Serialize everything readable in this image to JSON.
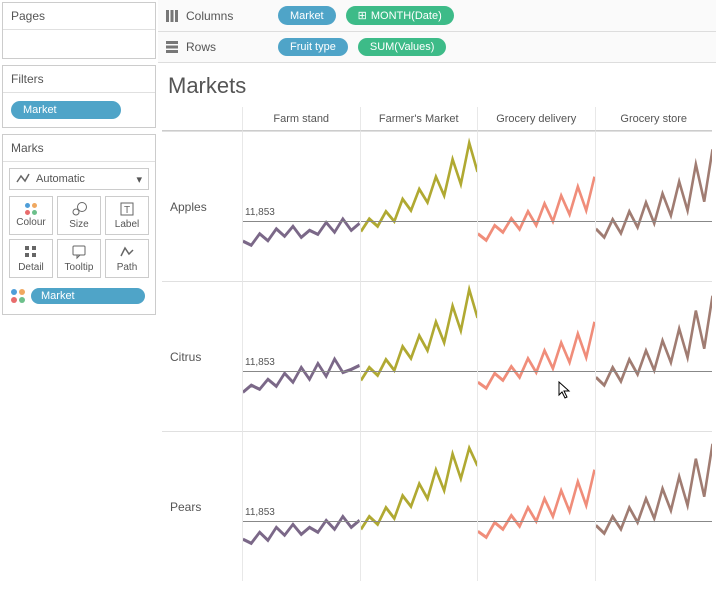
{
  "sidebar": {
    "pages_title": "Pages",
    "filters_title": "Filters",
    "filters_pill": "Market",
    "marks_title": "Marks",
    "marks_type": "Automatic",
    "marks_buttons": {
      "colour": "Colour",
      "size": "Size",
      "label": "Label",
      "detail": "Detail",
      "tooltip": "Tooltip",
      "path": "Path"
    },
    "marks_pill": "Market"
  },
  "shelves": {
    "columns_label": "Columns",
    "columns_pills": [
      "Market",
      "MONTH(Date)"
    ],
    "rows_label": "Rows",
    "rows_pills": [
      "Fruit type",
      "SUM(Values)"
    ]
  },
  "viz": {
    "title": "Markets",
    "col_headers": [
      "Farm stand",
      "Farmer's Market",
      "Grocery delivery",
      "Grocery store"
    ],
    "row_headers": [
      "Apples",
      "Citrus",
      "Pears"
    ],
    "ref_label": "11,853"
  },
  "chart_data": {
    "type": "line",
    "title": "Markets",
    "facet_cols": [
      "Farm stand",
      "Farmer's Market",
      "Grocery delivery",
      "Grocery store"
    ],
    "facet_rows": [
      "Apples",
      "Citrus",
      "Pears"
    ],
    "x_dimension": "MONTH(Date)",
    "y_measure": "SUM(Values)",
    "reference_line_value": 11853,
    "y_range_est": [
      0,
      30000
    ],
    "x_count": 36,
    "colors": {
      "Farm stand": "#7b6888",
      "Farmer's Market": "#b0a932",
      "Grocery delivery": "#f08d7a",
      "Grocery store": "#a07c72"
    },
    "series_estimated": {
      "Apples": {
        "Farm stand": [
          8000,
          7200,
          9500,
          8100,
          10500,
          9000,
          11000,
          8800,
          10200,
          9400,
          11800,
          9800,
          12500,
          10200,
          11600
        ],
        "Farmer's Market": [
          10000,
          12500,
          11000,
          14000,
          12000,
          16500,
          14200,
          18500,
          15800,
          21000,
          17200,
          24500,
          19500,
          27800,
          22000
        ],
        "Grocery delivery": [
          9500,
          8200,
          11200,
          9800,
          12600,
          10400,
          14000,
          11200,
          15600,
          12000,
          17200,
          13400,
          19000,
          14200,
          21000
        ],
        "Grocery store": [
          10500,
          8800,
          12400,
          9600,
          14000,
          10800,
          15800,
          11600,
          17600,
          13200,
          20000,
          14200,
          23500,
          16000,
          26500
        ]
      },
      "Citrus": {
        "Farm stand": [
          7800,
          9200,
          8400,
          10400,
          9000,
          11600,
          9800,
          12800,
          10400,
          13600,
          11000,
          14500,
          11800,
          12400,
          13200
        ],
        "Farmer's Market": [
          10200,
          12800,
          11200,
          14400,
          12200,
          17000,
          14600,
          19200,
          16200,
          22000,
          17800,
          25200,
          20200,
          28500,
          22800
        ],
        "Grocery delivery": [
          9800,
          8600,
          11600,
          10200,
          13000,
          10800,
          14600,
          11800,
          16200,
          12600,
          17800,
          13800,
          19600,
          14800,
          22000
        ],
        "Grocery store": [
          10800,
          9200,
          12800,
          10000,
          14400,
          11400,
          16200,
          12200,
          18200,
          13800,
          20600,
          14800,
          24200,
          16600,
          27200
        ]
      },
      "Pears": {
        "Farm stand": [
          8400,
          7600,
          9800,
          8200,
          10800,
          9200,
          11400,
          9400,
          10800,
          9800,
          12200,
          10400,
          13000,
          10800,
          12200
        ],
        "Farmer's Market": [
          10400,
          13000,
          11400,
          14800,
          12600,
          17200,
          15000,
          19600,
          16600,
          22400,
          18200,
          25600,
          20600,
          26800,
          23200
        ],
        "Grocery delivery": [
          10000,
          8800,
          11800,
          10400,
          13200,
          11000,
          14800,
          12000,
          16600,
          13000,
          18200,
          14000,
          20000,
          15200,
          22400
        ],
        "Grocery store": [
          11200,
          9600,
          13000,
          10400,
          14800,
          11800,
          16600,
          12600,
          18600,
          14200,
          21000,
          15200,
          24600,
          17000,
          27600
        ]
      }
    }
  }
}
